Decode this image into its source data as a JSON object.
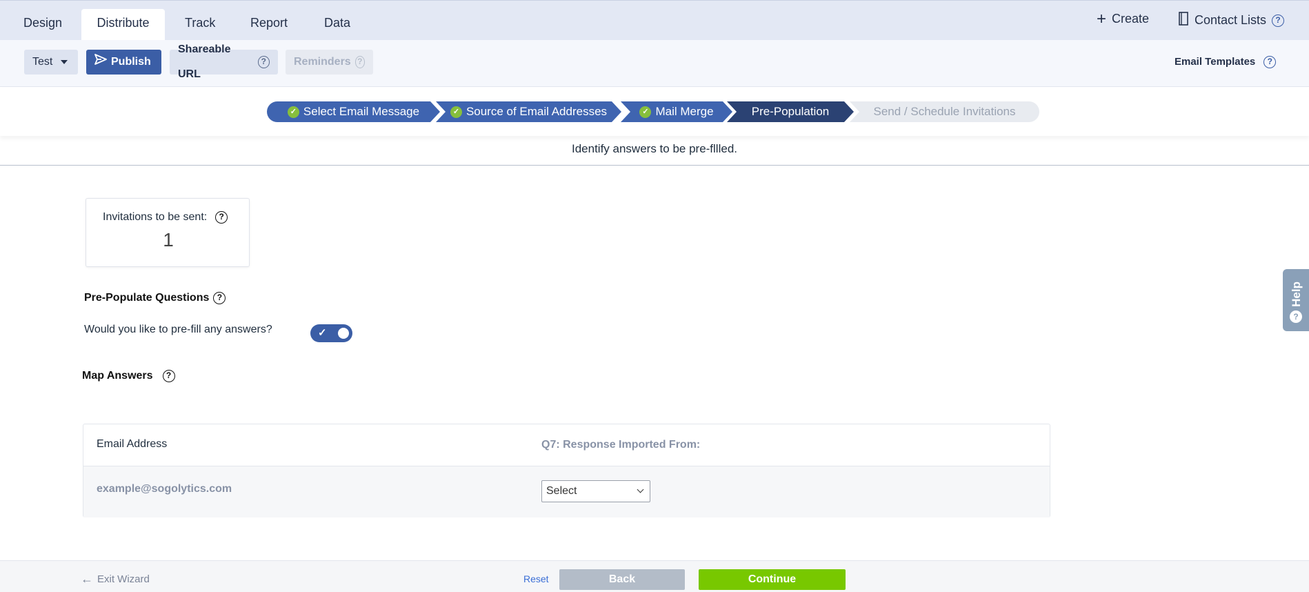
{
  "tabs": [
    {
      "label": "Design"
    },
    {
      "label": "Distribute"
    },
    {
      "label": "Track"
    },
    {
      "label": "Report"
    },
    {
      "label": "Data"
    }
  ],
  "top_right": {
    "create": "Create",
    "contact_lists": "Contact Lists"
  },
  "toolbar": {
    "test": "Test",
    "publish": "Publish",
    "shareable_url": "Shareable URL",
    "reminders": "Reminders",
    "email_templates": "Email Templates"
  },
  "steps": [
    {
      "label": "Select Email Message",
      "state": "done"
    },
    {
      "label": "Source of Email Addresses",
      "state": "done"
    },
    {
      "label": "Mail Merge",
      "state": "done"
    },
    {
      "label": "Pre-Population",
      "state": "current"
    },
    {
      "label": "Send / Schedule Invitations",
      "state": "todo"
    }
  ],
  "subtitle": "Identify answers to be pre-fllled.",
  "invitations": {
    "label": "Invitations to be sent:",
    "count": "1"
  },
  "prepopulate": {
    "title": "Pre-Populate Questions",
    "question": "Would you like to pre-fill any answers?",
    "enabled": true
  },
  "map_answers": {
    "title": "Map Answers",
    "columns": [
      "Email Address",
      "Q7: Response Imported From:"
    ],
    "rows": [
      {
        "email": "example@sogolytics.com",
        "select_value": "Select"
      }
    ]
  },
  "footer": {
    "exit": "Exit Wizard",
    "reset": "Reset",
    "back": "Back",
    "continue": "Continue"
  },
  "help_tab": "Help",
  "colors": {
    "primary": "#3b5ea6",
    "current_step": "#2b4273",
    "continue": "#78c800",
    "check": "#87bf3c"
  }
}
